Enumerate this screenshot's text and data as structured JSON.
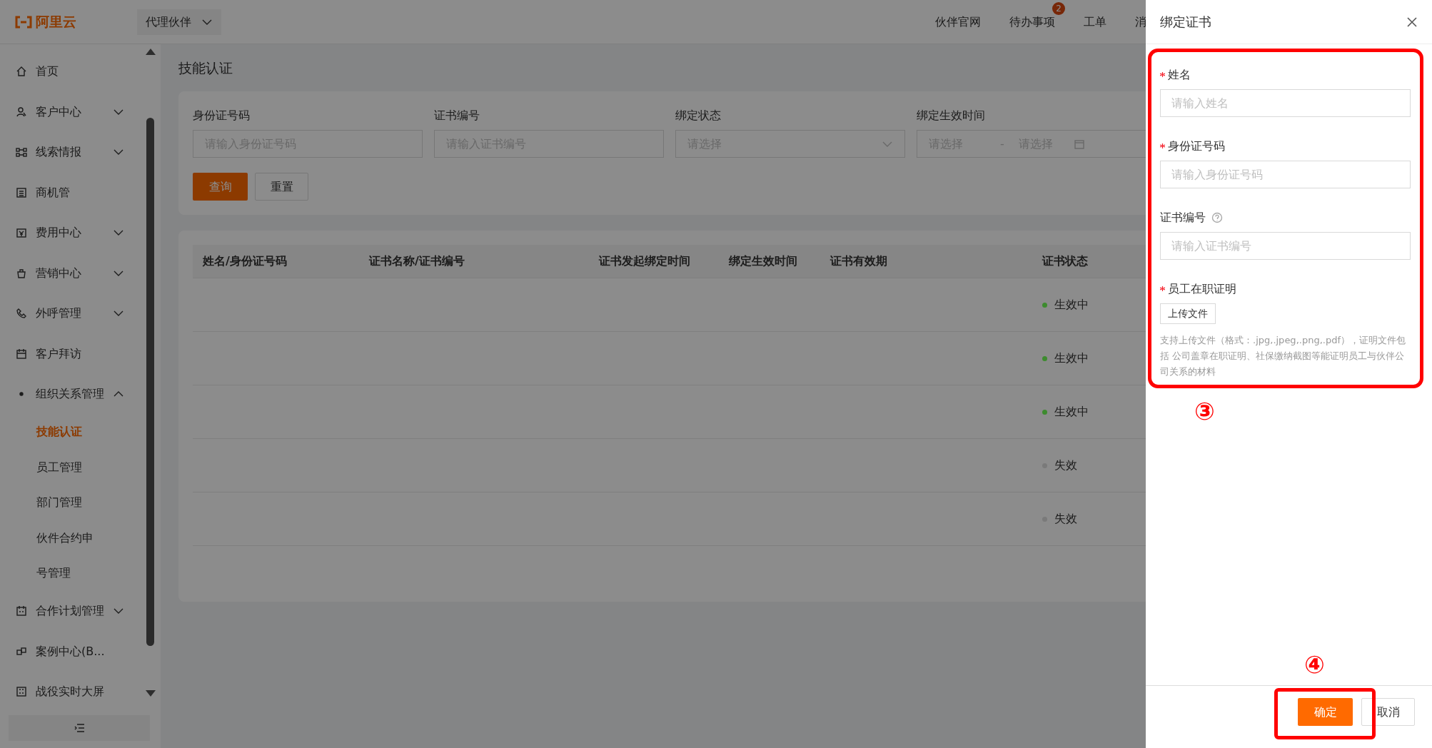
{
  "topbar": {
    "logo": "阿里云",
    "partner_switch": "代理伙伴",
    "partner_switch_expanded": false,
    "nav": [
      {
        "label": "伙伴官网"
      },
      {
        "label": "待办事项",
        "badge": "2"
      },
      {
        "label": "工单"
      },
      {
        "label": "消"
      }
    ]
  },
  "sidebar": {
    "items": [
      {
        "label": "首页"
      },
      {
        "label": "客户中心",
        "expanded": false
      },
      {
        "label": "线索情报",
        "expanded": false
      },
      {
        "label": "商机管"
      },
      {
        "label": "费用中心",
        "expanded": false
      },
      {
        "label": "营销中心",
        "expanded": false
      },
      {
        "label": "外呼管理",
        "expanded": false
      },
      {
        "label": "客户拜访"
      },
      {
        "label": "组织关系管理",
        "expanded": true,
        "children": [
          {
            "label": "技能认证",
            "selected": true
          },
          {
            "label": "员工管理",
            "selected": false
          },
          {
            "label": "部门管理",
            "selected": false
          },
          {
            "label": "伙件合约申",
            "selected": false
          },
          {
            "label": "号管理",
            "selected": false
          }
        ]
      },
      {
        "label": "合作计划管理",
        "expanded": false
      },
      {
        "label": "案例中心(B..."
      },
      {
        "label": "战役实时大屏"
      }
    ]
  },
  "page": {
    "title": "技能认证"
  },
  "filters": [
    {
      "kind": "text",
      "label": "身份证号码",
      "placeholder": "请输入身份证号码"
    },
    {
      "kind": "text",
      "label": "证书编号",
      "placeholder": "请输入证书编号"
    },
    {
      "kind": "select",
      "label": "绑定状态",
      "placeholder": "请选择"
    },
    {
      "kind": "daterange",
      "label": "绑定生效时间",
      "start_placeholder": "请选择",
      "separator": "-",
      "end_placeholder": "请选择"
    }
  ],
  "filter_buttons": [
    {
      "kind": "primary",
      "label": "查询"
    },
    {
      "kind": "default",
      "label": "重置"
    }
  ],
  "table": {
    "columns": [
      "姓名/身份证号码",
      "证书名称/证书编号",
      "证书发起绑定时间",
      "绑定生效时间",
      "证书有效期",
      "证书状态"
    ],
    "rows": [
      {
        "status": "生效中",
        "color": "#3d8b2e"
      },
      {
        "status": "生效中",
        "color": "#3d8b2e"
      },
      {
        "status": "生效中",
        "color": "#3d8b2e"
      },
      {
        "status": "失效",
        "color": "#7a7a7a"
      },
      {
        "status": "失效",
        "color": "#7a7a7a"
      }
    ]
  },
  "drawer": {
    "title": "绑定证书",
    "fields": [
      {
        "kind": "text",
        "label": "姓名",
        "required": true,
        "placeholder": "请输入姓名"
      },
      {
        "kind": "text",
        "label": "身份证号码",
        "required": true,
        "placeholder": "请输入身份证号码"
      },
      {
        "kind": "text",
        "label": "证书编号",
        "required": false,
        "help": true,
        "placeholder": "请输入证书编号"
      },
      {
        "kind": "upload",
        "label": "员工在职证明",
        "required": true,
        "button": "上传文件",
        "hint": "支持上传文件（格式：.jpg,.jpeg,.png,.pdf），证明文件包括 公司盖章在职证明、社保缴纳截图等能证明员工与伙伴公司关系的材料"
      }
    ],
    "buttons": [
      {
        "kind": "primary",
        "label": "确定"
      },
      {
        "kind": "default",
        "label": "取消"
      }
    ]
  },
  "annotations": [
    {
      "label": "③"
    },
    {
      "label": "④"
    }
  ]
}
